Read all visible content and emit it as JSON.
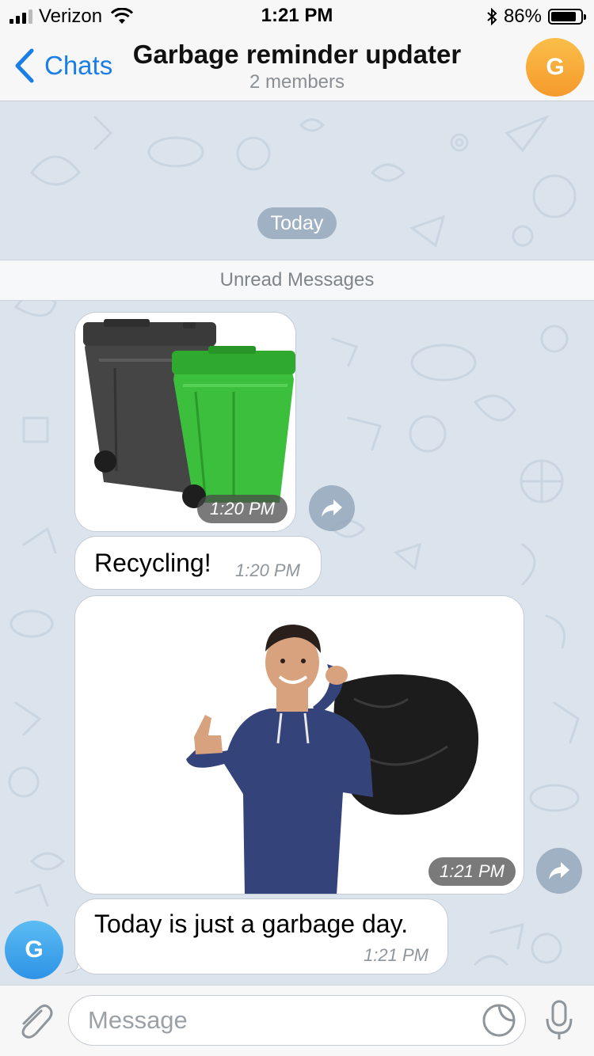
{
  "status_bar": {
    "carrier": "Verizon",
    "time": "1:21 PM",
    "battery_percent": "86%",
    "battery_level": 0.86,
    "icons": [
      "signal-icon",
      "wifi-icon",
      "bluetooth-icon",
      "battery-icon"
    ]
  },
  "header": {
    "back_label": "Chats",
    "title": "Garbage reminder updater",
    "subtitle": "2 members",
    "avatar_initial": "G",
    "avatar_color": "#f7a93a"
  },
  "chat": {
    "date_label": "Today",
    "unread_label": "Unread Messages",
    "messages": [
      {
        "type": "photo",
        "time": "1:20 PM",
        "image": "wheelie-bins-photo"
      },
      {
        "type": "text",
        "text": "Recycling!",
        "time": "1:20 PM"
      },
      {
        "type": "photo",
        "time": "1:21 PM",
        "image": "man-with-garbage-bag-photo"
      },
      {
        "type": "text",
        "text": "Today is just a garbage day.",
        "time": "1:21 PM"
      }
    ],
    "sender_avatar_initial": "G",
    "sender_avatar_color": "#3ca3ea"
  },
  "input": {
    "placeholder": "Message"
  },
  "colors": {
    "accent": "#1a7ee6",
    "chat_background": "#dbe4ed",
    "bubble": "#ffffff"
  }
}
